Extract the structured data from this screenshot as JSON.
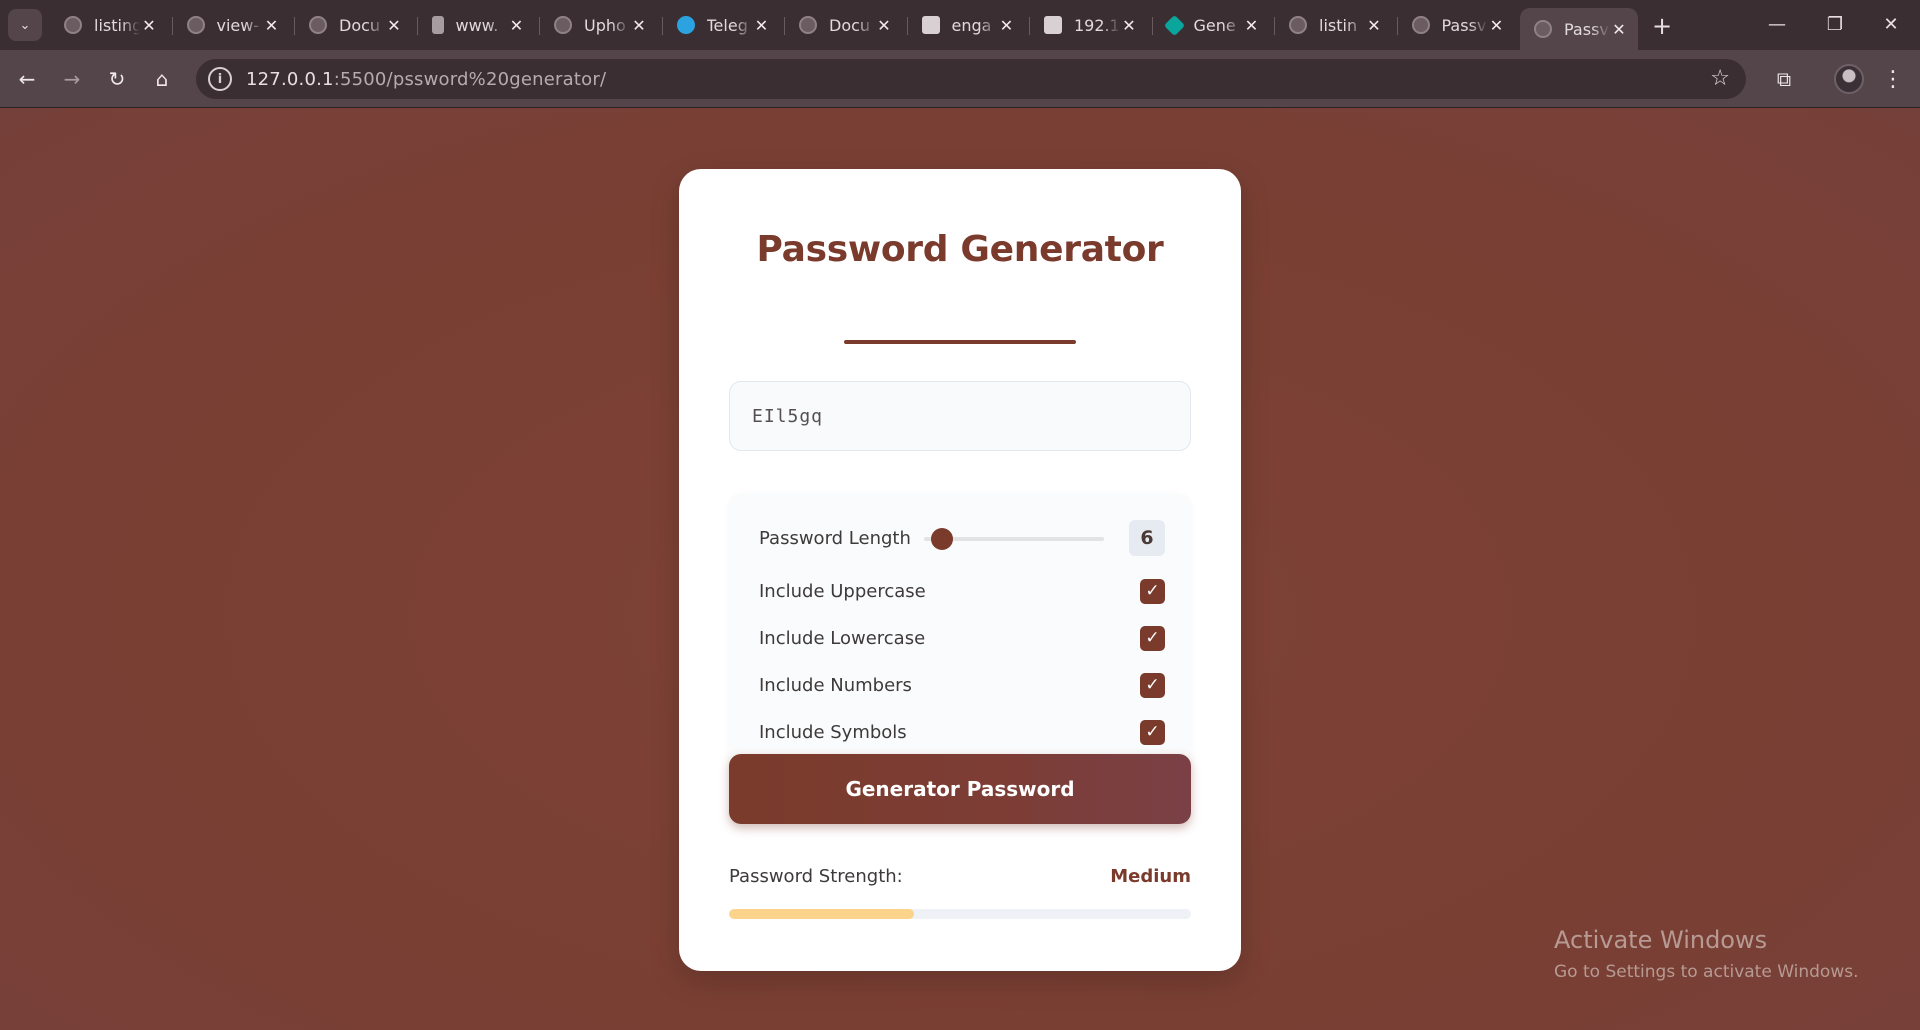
{
  "browser": {
    "tabs": [
      {
        "title": "listing",
        "icon": "globe-icon"
      },
      {
        "title": "view-",
        "icon": "globe-icon"
      },
      {
        "title": "Docu",
        "icon": "globe-icon"
      },
      {
        "title": "www.",
        "icon": "figma-icon"
      },
      {
        "title": "Upho",
        "icon": "globe-icon"
      },
      {
        "title": "Teleg",
        "icon": "telegram-icon"
      },
      {
        "title": "Docu",
        "icon": "globe-icon"
      },
      {
        "title": "enga",
        "icon": "doc-icon"
      },
      {
        "title": "192.1",
        "icon": "router-icon"
      },
      {
        "title": "Gene",
        "icon": "gemini-icon"
      },
      {
        "title": "listin",
        "icon": "globe-icon"
      },
      {
        "title": "Passv",
        "icon": "globe-icon"
      },
      {
        "title": "Passv",
        "icon": "globe-icon",
        "active": true
      }
    ],
    "url_host": "127.0.0.1",
    "url_rest": ":5500/pssword%20generator/"
  },
  "app": {
    "title": "Password Generator",
    "password_value": "EIl5gq",
    "length_label": "Password Length",
    "length_value": "6",
    "length_slider": {
      "min": 4,
      "max": 32,
      "value": 6
    },
    "options": [
      {
        "label": "Include Uppercase",
        "checked": true
      },
      {
        "label": "Include Lowercase",
        "checked": true
      },
      {
        "label": "Include Numbers",
        "checked": true
      },
      {
        "label": "Include Symbols",
        "checked": true
      }
    ],
    "check_glyph": "✓",
    "generate_label": "Generator Password",
    "strength_label": "Password Strength:",
    "strength_value": "Medium",
    "strength_fraction": 0.4
  },
  "watermark": {
    "line1": "Activate Windows",
    "line2": "Go to Settings to activate Windows."
  },
  "colors": {
    "accent": "#7a3a2c",
    "background": "#7a3f33",
    "strength_fill": "#fcd38a"
  }
}
